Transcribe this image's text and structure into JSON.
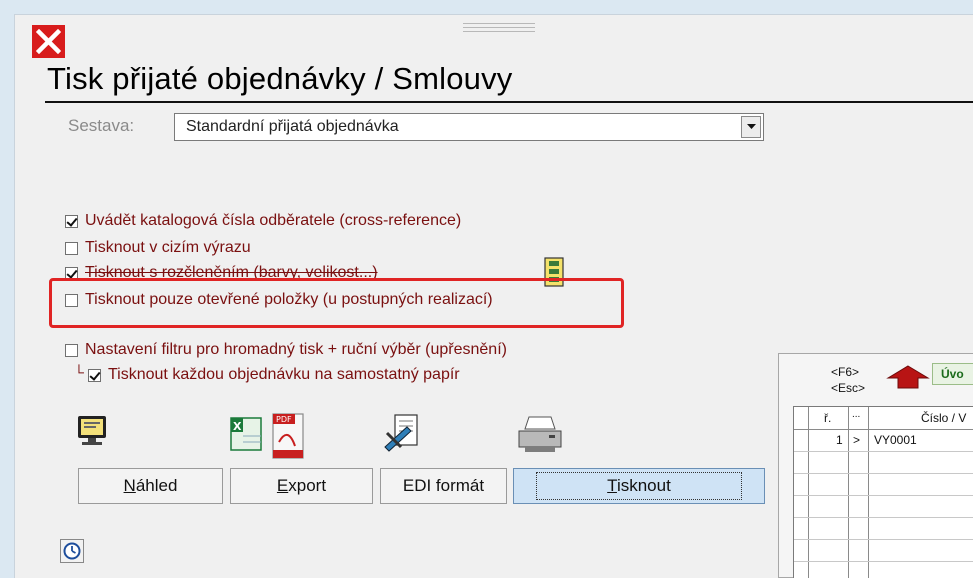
{
  "window": {
    "title": "Tisk přijaté objednávky / Smlouvy"
  },
  "report": {
    "label": "Sestava:",
    "selected": "Standardní přijatá objednávka"
  },
  "options": [
    {
      "label": "Uvádět katalogová čísla odběratele (cross-reference)",
      "checked": true
    },
    {
      "label": "Tisknout v cizím výrazu",
      "checked": false
    },
    {
      "label": "Tisknout s rozčleněním (barvy, velikost...)",
      "checked": true
    },
    {
      "label": "Tisknout pouze otevřené položky (u postupných realizací)",
      "checked": false
    },
    {
      "label": "Nastavení filtru pro hromadný tisk + ruční výběr (upřesnění)",
      "checked": false
    },
    {
      "label": "Tisknout každou objednávku na samostatný papír",
      "checked": true
    }
  ],
  "buttons": {
    "preview": {
      "underline": "N",
      "rest": "áhled"
    },
    "export": {
      "underline": "E",
      "rest": "xport"
    },
    "edi": "EDI formát",
    "print": {
      "underline": "T",
      "rest": "isknout"
    }
  },
  "icons": {
    "close": "close-icon",
    "preview": "preview-monitor-icon",
    "export": "excel-pdf-export-icon",
    "edi": "edi-document-icon",
    "print": "printer-icon",
    "filter": "filter-settings-icon",
    "history": "clock-icon",
    "back": "red-arrow-up-icon"
  },
  "colors": {
    "option_text": "#7a1010",
    "highlight": "#e02424",
    "close_bg": "#d81c1c",
    "print_button_bg": "#cfe3f5"
  },
  "side_panel": {
    "key_f6": "<F6>",
    "key_esc": "<Esc>",
    "tab_label": "Úvo",
    "columns": [
      "ř.",
      "...",
      "Číslo / V"
    ],
    "rows": [
      {
        "num": "1",
        "marker": ">",
        "number": "VY0001"
      }
    ]
  }
}
